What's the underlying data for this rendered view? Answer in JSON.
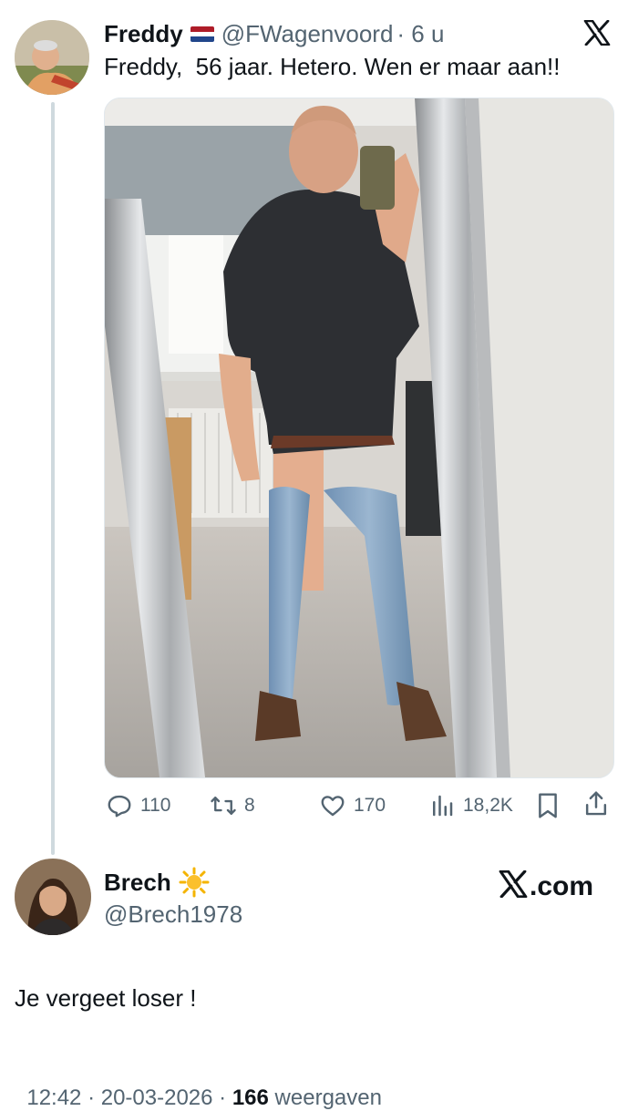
{
  "tweet": {
    "author_name": "Freddy",
    "author_handle": "@FWagenvoord",
    "time_ago": "· 6 u",
    "text": "Freddy,  56 jaar. Hetero. Wen er maar aan!!",
    "actions": {
      "replies": "110",
      "reposts": "8",
      "likes": "170",
      "views": "18,2K"
    }
  },
  "reply": {
    "author_name": "Brech",
    "author_handle": "@Brech1978",
    "brand": "X.com",
    "text": "Je vergeet loser !",
    "timestamp": "12:42 · 20-03-2026 · ",
    "views_count": "166",
    "views_label": " weergaven"
  },
  "icons": [
    "x-logo-icon",
    "nl-flag-icon",
    "reply-icon",
    "repost-icon",
    "like-icon",
    "views-icon",
    "bookmark-icon",
    "share-icon",
    "sun-emoji-icon"
  ],
  "colors": {
    "secondary_text": "#536471",
    "thread_line": "#cfd9de"
  }
}
